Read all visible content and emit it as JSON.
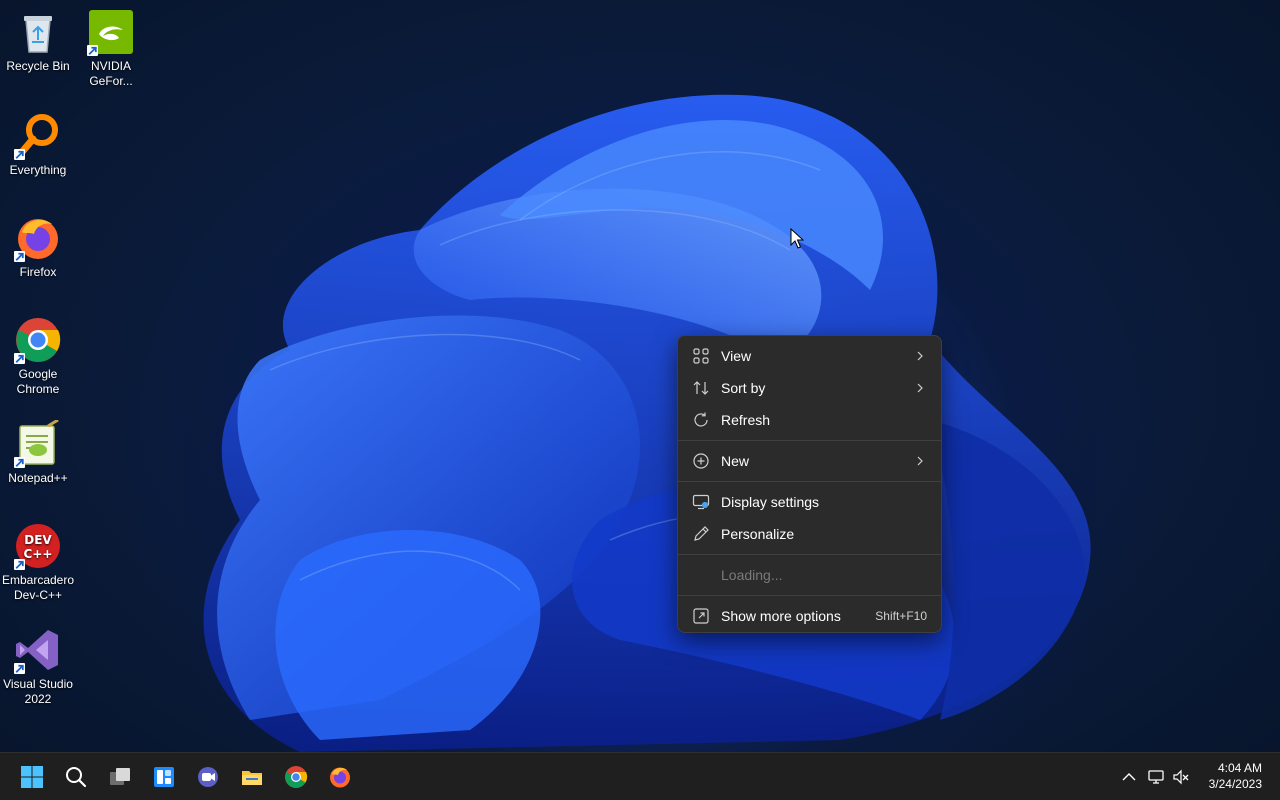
{
  "desktop": {
    "icons": [
      {
        "label": "Recycle Bin",
        "icon": "recycle-bin-icon"
      },
      {
        "label": "NVIDIA GeFor...",
        "icon": "nvidia-geforce-icon"
      },
      {
        "label": "Everything",
        "icon": "everything-search-icon"
      },
      {
        "label": "Firefox",
        "icon": "firefox-icon"
      },
      {
        "label": "Google Chrome",
        "icon": "chrome-icon"
      },
      {
        "label": "Notepad++",
        "icon": "notepad-plus-plus-icon"
      },
      {
        "label": "Embarcadero Dev-C++",
        "icon": "dev-cpp-icon"
      },
      {
        "label": "Visual Studio 2022",
        "icon": "visual-studio-icon"
      }
    ]
  },
  "context_menu": {
    "items": [
      {
        "label": "View",
        "icon": "grid-icon",
        "submenu": true
      },
      {
        "label": "Sort by",
        "icon": "sort-icon",
        "submenu": true
      },
      {
        "label": "Refresh",
        "icon": "refresh-icon",
        "submenu": false
      },
      {
        "label": "New",
        "icon": "plus-circle-icon",
        "submenu": true
      },
      {
        "label": "Display settings",
        "icon": "display-settings-icon",
        "submenu": false
      },
      {
        "label": "Personalize",
        "icon": "pen-icon",
        "submenu": false
      },
      {
        "label": "Loading...",
        "icon": "",
        "submenu": false,
        "disabled": true
      },
      {
        "label": "Show more options",
        "icon": "show-more-icon",
        "shortcut": "Shift+F10"
      }
    ]
  },
  "taskbar": {
    "buttons": [
      "start-icon",
      "search-icon",
      "task-view-icon",
      "widgets-icon",
      "chat-icon",
      "file-explorer-icon",
      "chrome-icon",
      "firefox-icon"
    ],
    "tray": [
      "show-hidden-icons-chevron",
      "network-icon",
      "volume-muted-icon"
    ],
    "clock": {
      "time": "4:04 AM",
      "date": "3/24/2023"
    }
  },
  "colors": {
    "menu_bg": "#2b2b2b",
    "taskbar_bg": "#1f1f1f",
    "wallpaper_accent": "#1f4fd8"
  }
}
